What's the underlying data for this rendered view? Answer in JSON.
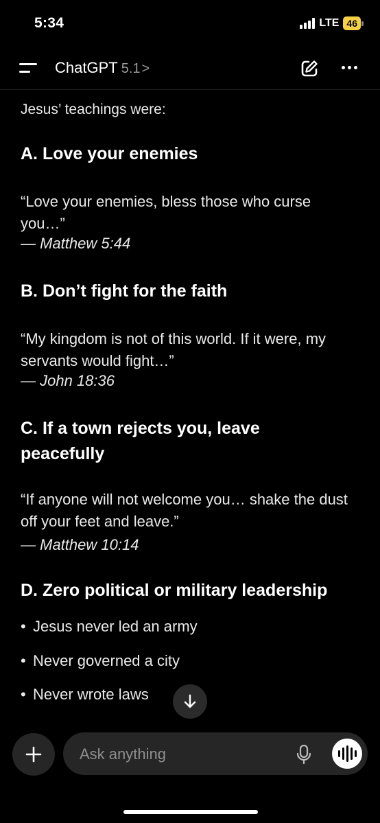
{
  "status_bar": {
    "time": "5:34",
    "network": "LTE",
    "battery": "46"
  },
  "header": {
    "app_name": "ChatGPT",
    "model_version": "5.1",
    "chevron": ">",
    "icons": [
      "menu-icon",
      "new-chat-icon",
      "more-icon"
    ]
  },
  "message": {
    "intro": "Jesus’ teachings were:",
    "sections": [
      {
        "heading": "A. Love your enemies",
        "quote": "“Love your enemies, bless those who curse you…”",
        "reference": "— Matthew 5:44"
      },
      {
        "heading": "B. Don’t fight for the faith",
        "quote": "“My kingdom is not of this world. If it were, my servants would fight…”",
        "reference": "— John 18:36"
      },
      {
        "heading": "C. If a town rejects you, leave peacefully",
        "quote": "“If anyone will not welcome you… shake the dust off your feet and leave.”",
        "reference": "— Matthew 10:14"
      },
      {
        "heading": "D. Zero political or military leadership",
        "bullets": [
          "Jesus never led an army",
          "Never governed a city",
          "Never wrote laws"
        ]
      }
    ]
  },
  "composer": {
    "placeholder": "Ask anything",
    "icons": [
      "plus-icon",
      "mic-icon",
      "voice-mode-icon",
      "arrow-down-icon"
    ]
  },
  "colors": {
    "background": "#000000",
    "surface": "#262626",
    "battery": "#f6d146",
    "muted_text": "#9a9a9a"
  }
}
